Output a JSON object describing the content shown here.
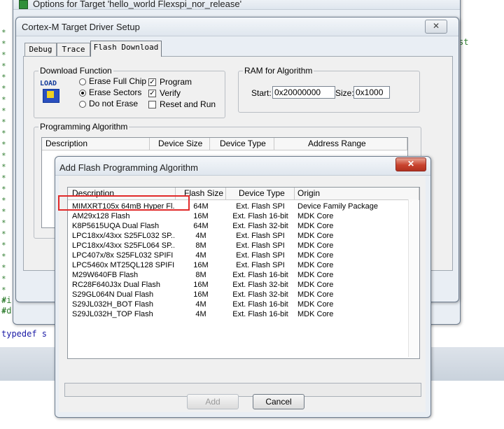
{
  "outer_window": {
    "title": "Options for Target 'hello_world Flexspi_nor_release'",
    "right_fragment": "st"
  },
  "editor": {
    "lines": [
      "#i",
      "#d",
      "typedef s"
    ],
    "gutter_char": "*"
  },
  "driver_dialog": {
    "title": "Cortex-M Target Driver Setup",
    "close_glyph": "✕",
    "tabs": [
      "Debug",
      "Trace",
      "Flash Download"
    ],
    "download_function": {
      "label": "Download Function",
      "icon_text": "LOAD",
      "options": [
        "Erase Full Chip",
        "Erase Sectors",
        "Do not Erase"
      ],
      "selected": "Erase Sectors",
      "checks": [
        {
          "label": "Program",
          "checked": true
        },
        {
          "label": "Verify",
          "checked": true
        },
        {
          "label": "Reset and Run",
          "checked": false
        }
      ]
    },
    "ram": {
      "label": "RAM for Algorithm",
      "start_label": "Start:",
      "start_value": "0x20000000",
      "size_label": "Size:",
      "size_value": "0x1000"
    },
    "programming_algorithm": {
      "label": "Programming Algorithm",
      "columns": [
        "Description",
        "Device Size",
        "Device Type",
        "Address Range"
      ]
    }
  },
  "add_dialog": {
    "title": "Add Flash Programming Algorithm",
    "close_glyph": "✕",
    "columns": [
      "Description",
      "Flash Size",
      "Device Type",
      "Origin"
    ],
    "rows": [
      {
        "desc": "MIMXRT105x 64mB Hyper Fl...",
        "size": "64M",
        "type": "Ext. Flash SPI",
        "origin": "Device Family Package"
      },
      {
        "desc": "AM29x128 Flash",
        "size": "16M",
        "type": "Ext. Flash 16-bit",
        "origin": "MDK Core"
      },
      {
        "desc": "K8P5615UQA Dual Flash",
        "size": "64M",
        "type": "Ext. Flash 32-bit",
        "origin": "MDK Core"
      },
      {
        "desc": "LPC18xx/43xx S25FL032 SP...",
        "size": "4M",
        "type": "Ext. Flash SPI",
        "origin": "MDK Core"
      },
      {
        "desc": "LPC18xx/43xx S25FL064 SP...",
        "size": "8M",
        "type": "Ext. Flash SPI",
        "origin": "MDK Core"
      },
      {
        "desc": "LPC407x/8x S25FL032 SPIFI",
        "size": "4M",
        "type": "Ext. Flash SPI",
        "origin": "MDK Core"
      },
      {
        "desc": "LPC5460x MT25QL128 SPIFI",
        "size": "16M",
        "type": "Ext. Flash SPI",
        "origin": "MDK Core"
      },
      {
        "desc": "M29W640FB Flash",
        "size": "8M",
        "type": "Ext. Flash 16-bit",
        "origin": "MDK Core"
      },
      {
        "desc": "RC28F640J3x Dual Flash",
        "size": "16M",
        "type": "Ext. Flash 32-bit",
        "origin": "MDK Core"
      },
      {
        "desc": "S29GL064N Dual Flash",
        "size": "16M",
        "type": "Ext. Flash 32-bit",
        "origin": "MDK Core"
      },
      {
        "desc": "S29JL032H_BOT Flash",
        "size": "4M",
        "type": "Ext. Flash 16-bit",
        "origin": "MDK Core"
      },
      {
        "desc": "S29JL032H_TOP Flash",
        "size": "4M",
        "type": "Ext. Flash 16-bit",
        "origin": "MDK Core"
      }
    ],
    "add_label": "Add",
    "cancel_label": "Cancel",
    "highlight_color": "#e12a2a"
  }
}
